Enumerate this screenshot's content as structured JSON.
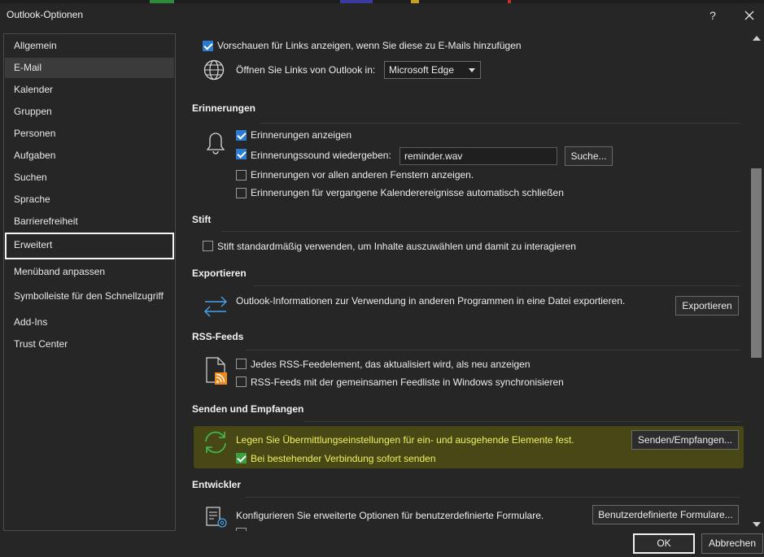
{
  "window": {
    "title": "Outlook-Optionen",
    "help_label": "?"
  },
  "nav": {
    "items": [
      {
        "label": "Allgemein"
      },
      {
        "label": "E-Mail"
      },
      {
        "label": "Kalender"
      },
      {
        "label": "Gruppen"
      },
      {
        "label": "Personen"
      },
      {
        "label": "Aufgaben"
      },
      {
        "label": "Suchen"
      },
      {
        "label": "Sprache"
      },
      {
        "label": "Barrierefreiheit"
      },
      {
        "label": "Erweitert"
      },
      {
        "label": "Menüband anpassen"
      },
      {
        "label": "Symbolleiste für den Schnellzugriff"
      },
      {
        "label": "Add-Ins"
      },
      {
        "label": "Trust Center"
      }
    ],
    "active_item": "E-Mail",
    "focused_item": "Erweitert"
  },
  "links": {
    "preview_label": "Vorschauen für Links anzeigen, wenn Sie diese zu E-Mails hinzufügen",
    "preview_checked": true,
    "open_links_label": "Öffnen Sie Links von Outlook in:",
    "browser_value": "Microsoft Edge"
  },
  "reminders": {
    "title": "Erinnerungen",
    "show_label": "Erinnerungen anzeigen",
    "show_checked": true,
    "sound_label": "Erinnerungssound wiedergeben:",
    "sound_checked": true,
    "sound_file": "reminder.wav",
    "browse_label": "Suche...",
    "on_top_label": "Erinnerungen vor allen anderen Fenstern anzeigen.",
    "on_top_checked": false,
    "auto_dismiss_label": "Erinnerungen für vergangene Kalenderereignisse automatisch schließen",
    "auto_dismiss_checked": false
  },
  "pen": {
    "title": "Stift",
    "default_label": "Stift standardmäßig verwenden, um Inhalte auszuwählen und damit zu interagieren",
    "default_checked": false
  },
  "export": {
    "title": "Exportieren",
    "description": "Outlook-Informationen zur Verwendung in anderen Programmen in eine Datei exportieren.",
    "button_label": "Exportieren"
  },
  "rss": {
    "title": "RSS-Feeds",
    "new_items_label": "Jedes RSS-Feedelement, das aktualisiert wird, als neu anzeigen",
    "new_items_checked": false,
    "sync_label": "RSS-Feeds mit der gemeinsamen Feedliste in Windows synchronisieren",
    "sync_checked": false
  },
  "send_receive": {
    "title": "Senden und Empfangen",
    "description": "Legen Sie Übermittlungseinstellungen für ein- und ausgehende Elemente fest.",
    "button_label": "Senden/Empfangen...",
    "send_immediately_label": "Bei bestehender Verbindung sofort senden",
    "send_immediately_checked": true
  },
  "developer": {
    "title": "Entwickler",
    "description": "Konfigurieren Sie erweiterte Optionen für benutzerdefinierte Formulare.",
    "button_label": "Benutzerdefinierte Formulare..."
  },
  "footer": {
    "ok_label": "OK",
    "cancel_label": "Abbrechen"
  },
  "colors": {
    "background": "#262626",
    "accent": "#2b7bd0",
    "highlight": "#f0f060"
  }
}
